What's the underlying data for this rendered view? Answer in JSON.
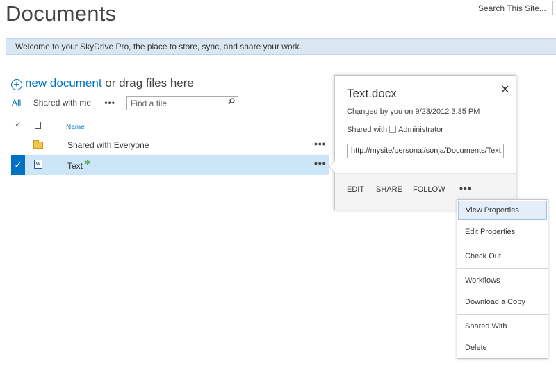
{
  "page": {
    "title": "Documents"
  },
  "search": {
    "placeholder": "Search This Site..."
  },
  "banner": {
    "text": "Welcome to your SkyDrive Pro, the place to store, sync, and share your work."
  },
  "new_document": {
    "plus": "+",
    "link": "new document",
    "rest": " or drag files here"
  },
  "views": {
    "all": "All",
    "shared": "Shared with me",
    "more": "•••"
  },
  "find": {
    "placeholder": "Find a file"
  },
  "list": {
    "header_check": "✓",
    "column_name": "Name",
    "rows": [
      {
        "name": "Shared with Everyone",
        "icon": "folder-icon",
        "more": "•••"
      },
      {
        "name": "Text",
        "icon": "word-doc-icon",
        "new_marker": "✻",
        "more": "•••",
        "selected": true,
        "check": "✓"
      }
    ]
  },
  "callout": {
    "title": "Text.docx",
    "close": "✕",
    "changed": "Changed by you on 9/23/2012 3:35 PM",
    "shared_prefix": "Shared with",
    "shared_with": "Administrator",
    "url": "http://mysite/personal/sonja/Documents/Text.docx",
    "actions": {
      "edit": "EDIT",
      "share": "SHARE",
      "follow": "FOLLOW",
      "more": "•••"
    }
  },
  "context_menu": {
    "items": [
      "View Properties",
      "Edit Properties",
      "Check Out",
      "Workflows",
      "Download a Copy",
      "Shared With",
      "Delete"
    ],
    "highlighted": "View Properties"
  },
  "colors": {
    "accent": "#0072c6",
    "banner": "#dbe6f3",
    "selected_row": "#cde6f7"
  }
}
